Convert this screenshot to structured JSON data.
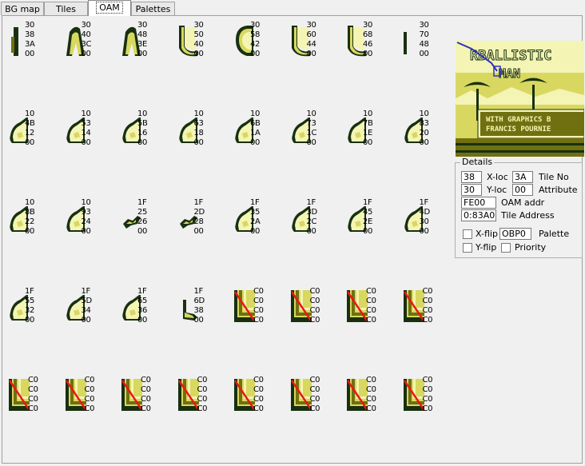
{
  "tabs": [
    "BG map",
    "Tiles",
    "OAM",
    "Palettes"
  ],
  "active_tab": "OAM",
  "colors": {
    "lightest": "#f4f4b4",
    "light": "#d8d860",
    "dark": "#707010",
    "darkest": "#183010",
    "marker": "#e81818"
  },
  "sprites": [
    {
      "lines": [
        "30",
        "38",
        "3A",
        "00"
      ],
      "shape": "bar"
    },
    {
      "lines": [
        "30",
        "40",
        "3C",
        "00"
      ],
      "shape": "arch"
    },
    {
      "lines": [
        "30",
        "48",
        "3E",
        "00"
      ],
      "shape": "arch"
    },
    {
      "lines": [
        "30",
        "50",
        "40",
        "00"
      ],
      "shape": "curve"
    },
    {
      "lines": [
        "30",
        "58",
        "42",
        "00"
      ],
      "shape": "ring"
    },
    {
      "lines": [
        "30",
        "60",
        "44",
        "00"
      ],
      "shape": "curve"
    },
    {
      "lines": [
        "30",
        "68",
        "46",
        "00"
      ],
      "shape": "curve"
    },
    {
      "lines": [
        "30",
        "70",
        "48",
        "00"
      ],
      "shape": "thin"
    },
    {
      "lines": [
        "10",
        "4B",
        "12",
        "00"
      ],
      "shape": "blob"
    },
    {
      "lines": [
        "10",
        "53",
        "14",
        "00"
      ],
      "shape": "blob"
    },
    {
      "lines": [
        "10",
        "5B",
        "16",
        "00"
      ],
      "shape": "blob"
    },
    {
      "lines": [
        "10",
        "63",
        "18",
        "00"
      ],
      "shape": "blob"
    },
    {
      "lines": [
        "10",
        "6B",
        "1A",
        "00"
      ],
      "shape": "blob"
    },
    {
      "lines": [
        "10",
        "73",
        "1C",
        "00"
      ],
      "shape": "blob"
    },
    {
      "lines": [
        "10",
        "7B",
        "1E",
        "00"
      ],
      "shape": "blob"
    },
    {
      "lines": [
        "10",
        "83",
        "20",
        "00"
      ],
      "shape": "blob"
    },
    {
      "lines": [
        "10",
        "8B",
        "22",
        "00"
      ],
      "shape": "blob"
    },
    {
      "lines": [
        "10",
        "93",
        "24",
        "00"
      ],
      "shape": "blob"
    },
    {
      "lines": [
        "1F",
        "25",
        "26",
        "00"
      ],
      "shape": "wisp"
    },
    {
      "lines": [
        "1F",
        "2D",
        "28",
        "00"
      ],
      "shape": "wisp"
    },
    {
      "lines": [
        "1F",
        "35",
        "2A",
        "00"
      ],
      "shape": "blob"
    },
    {
      "lines": [
        "1F",
        "3D",
        "2C",
        "00"
      ],
      "shape": "blob"
    },
    {
      "lines": [
        "1F",
        "45",
        "2E",
        "00"
      ],
      "shape": "blob"
    },
    {
      "lines": [
        "1F",
        "4D",
        "30",
        "00"
      ],
      "shape": "blob"
    },
    {
      "lines": [
        "1F",
        "55",
        "32",
        "00"
      ],
      "shape": "blob"
    },
    {
      "lines": [
        "1F",
        "5D",
        "34",
        "00"
      ],
      "shape": "blob"
    },
    {
      "lines": [
        "1F",
        "65",
        "36",
        "00"
      ],
      "shape": "blob"
    },
    {
      "lines": [
        "1F",
        "6D",
        "38",
        "00"
      ],
      "shape": "hook"
    },
    {
      "lines": [
        "C0",
        "C0",
        "C0",
        "C0"
      ],
      "shape": "empty"
    },
    {
      "lines": [
        "C0",
        "C0",
        "C0",
        "C0"
      ],
      "shape": "empty"
    },
    {
      "lines": [
        "C0",
        "C0",
        "C0",
        "C0"
      ],
      "shape": "empty"
    },
    {
      "lines": [
        "C0",
        "C0",
        "C0",
        "C0"
      ],
      "shape": "empty"
    },
    {
      "lines": [
        "C0",
        "C0",
        "C0",
        "C0"
      ],
      "shape": "empty"
    },
    {
      "lines": [
        "C0",
        "C0",
        "C0",
        "C0"
      ],
      "shape": "empty"
    },
    {
      "lines": [
        "C0",
        "C0",
        "C0",
        "C0"
      ],
      "shape": "empty"
    },
    {
      "lines": [
        "C0",
        "C0",
        "C0",
        "C0"
      ],
      "shape": "empty"
    },
    {
      "lines": [
        "C0",
        "C0",
        "C0",
        "C0"
      ],
      "shape": "empty"
    },
    {
      "lines": [
        "C0",
        "C0",
        "C0",
        "C0"
      ],
      "shape": "empty"
    },
    {
      "lines": [
        "C0",
        "C0",
        "C0",
        "C0"
      ],
      "shape": "empty"
    },
    {
      "lines": [
        "C0",
        "C0",
        "C0",
        "C0"
      ],
      "shape": "empty"
    }
  ],
  "preview": {
    "title_line1": "RBALLISTIC",
    "title_line2": "MAN",
    "credit_line1": "WITH GRAPHICS B",
    "credit_line2": "FRANCIS POURNIE"
  },
  "details": {
    "legend": "Details",
    "x_loc": {
      "value": "38",
      "label": "X-loc"
    },
    "y_loc": {
      "value": "30",
      "label": "Y-loc"
    },
    "tile_no": {
      "value": "3A",
      "label": "Tile No"
    },
    "attribute": {
      "value": "00",
      "label": "Attribute"
    },
    "oam_addr": {
      "value": "FE00",
      "label": "OAM addr"
    },
    "tile_address": {
      "value": "0:83A0",
      "label": "Tile Address"
    },
    "x_flip": {
      "label": "X-flip",
      "checked": false
    },
    "y_flip": {
      "label": "Y-flip",
      "checked": false
    },
    "palette": {
      "value": "OBP0",
      "label": "Palette"
    },
    "priority": {
      "label": "Priority",
      "checked": false
    }
  }
}
